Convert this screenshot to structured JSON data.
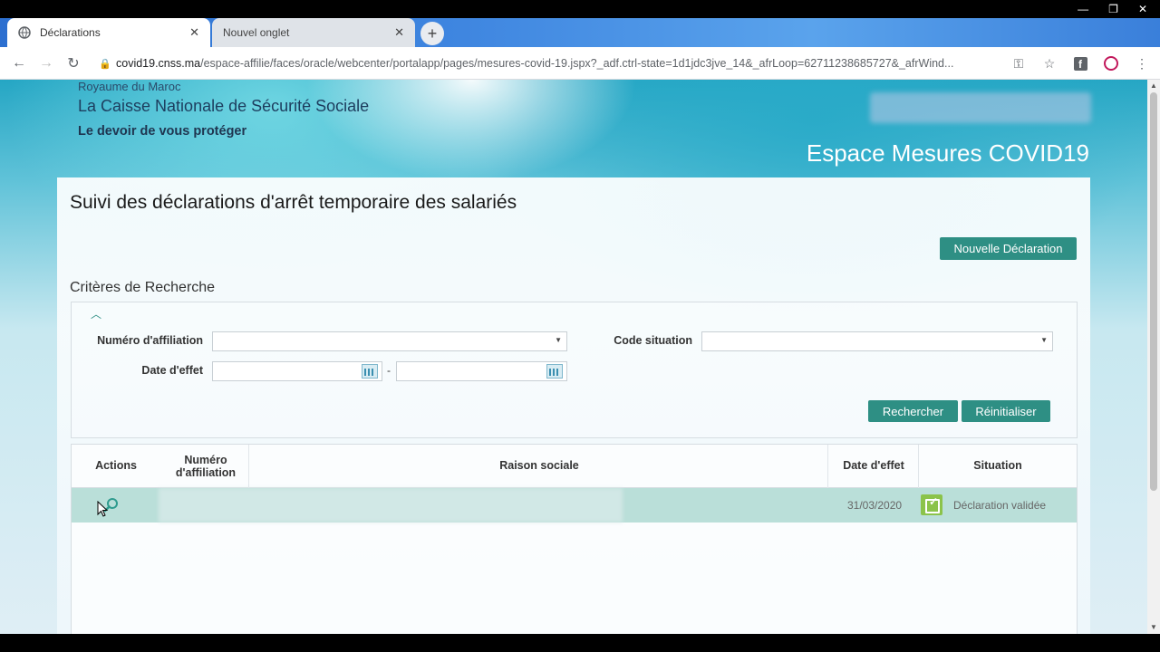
{
  "browser": {
    "tabs": [
      {
        "label": "Déclarations",
        "active": true
      },
      {
        "label": "Nouvel onglet",
        "active": false
      }
    ],
    "url_host": "covid19.cnss.ma",
    "url_path": "/espace-affilie/faces/oracle/webcenter/portalapp/pages/mesures-covid-19.jspx?_adf.ctrl-state=1d1jdc3jve_14&_afrLoop=62711238685727&_afrWind..."
  },
  "header": {
    "kingdom": "Royaume du Maroc",
    "org_name": "La Caisse Nationale de Sécurité Sociale",
    "motto": "Le devoir de vous protéger",
    "space_title": "Espace Mesures COVID19"
  },
  "page": {
    "title": "Suivi des déclarations d'arrêt temporaire des salariés",
    "new_button": "Nouvelle Déclaration",
    "criteria_label": "Critères de Recherche"
  },
  "search": {
    "affiliation_label": "Numéro d'affiliation",
    "code_label": "Code situation",
    "date_label": "Date d'effet",
    "date_separator": "-",
    "search_button": "Rechercher",
    "reset_button": "Réinitialiser"
  },
  "table": {
    "headers": {
      "actions": "Actions",
      "affiliation": "Numéro d'affiliation",
      "raison": "Raison sociale",
      "date": "Date d'effet",
      "situation": "Situation"
    },
    "rows": [
      {
        "date": "31/03/2020",
        "situation": "Déclaration validée",
        "status_color": "#8bc34a"
      }
    ]
  },
  "colors": {
    "accent": "#2e8f84"
  }
}
